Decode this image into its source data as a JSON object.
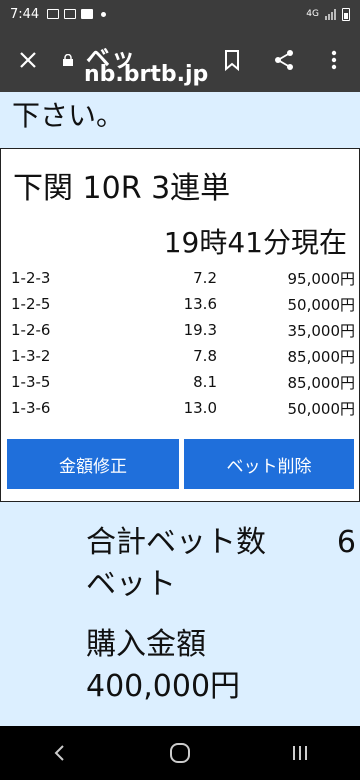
{
  "status_bar": {
    "time": "7:44",
    "network": "4G"
  },
  "browser": {
    "title": "ベッ",
    "url": "nb.brtb.jp"
  },
  "page": {
    "top_text": "下さい。",
    "race_title": "下関 10R 3連単",
    "timestamp": "19時41分現在",
    "bets": [
      {
        "combo": "1-2-3",
        "odds": "7.2",
        "amount": "95,000円"
      },
      {
        "combo": "1-2-5",
        "odds": "13.6",
        "amount": "50,000円"
      },
      {
        "combo": "1-2-6",
        "odds": "19.3",
        "amount": "35,000円"
      },
      {
        "combo": "1-3-2",
        "odds": "7.8",
        "amount": "85,000円"
      },
      {
        "combo": "1-3-5",
        "odds": "8.1",
        "amount": "85,000円"
      },
      {
        "combo": "1-3-6",
        "odds": "13.0",
        "amount": "50,000円"
      }
    ],
    "edit_button": "金額修正",
    "delete_button": "ベット削除",
    "total_bets_label": "合計ベット数",
    "total_bets_value": "6",
    "total_bets_unit": "ベット",
    "purchase_label": "購入金額",
    "purchase_value": "400,000円"
  },
  "colors": {
    "button": "#1f6fdb",
    "page_bg": "#dcefff",
    "chrome": "#3c3c3c"
  }
}
